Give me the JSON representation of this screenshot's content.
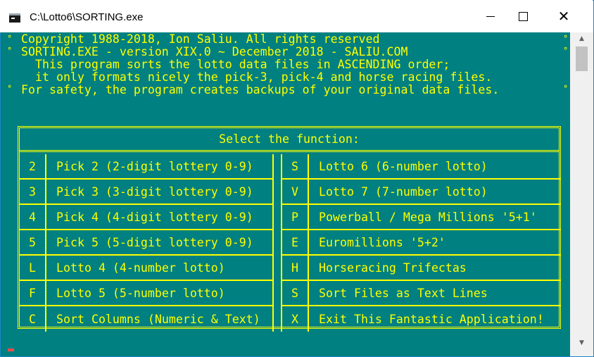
{
  "window": {
    "title": "C:\\Lotto6\\SORTING.exe",
    "buttons": {
      "minimize": "minimize",
      "maximize": "maximize",
      "close": "✕"
    }
  },
  "console": {
    "header_lines": [
      "Copyright 1988-2018, Ion Saliu. All rights reserved",
      "SORTING.EXE - version XIX.0 ~ December 2018 - SALIU.COM",
      "  This program sorts the lotto data files in ASCENDING order;",
      "  it only formats nicely the pick-3, pick-4 and horse racing files.",
      "For safety, the program creates backups of your original data files."
    ],
    "border_marker": "°"
  },
  "menu": {
    "title": "Select the function:",
    "left": [
      {
        "key": "2",
        "label": "Pick 2 (2-digit lottery 0-9)"
      },
      {
        "key": "3",
        "label": "Pick 3 (3-digit lottery 0-9)"
      },
      {
        "key": "4",
        "label": "Pick 4 (4-digit lottery 0-9)"
      },
      {
        "key": "5",
        "label": "Pick 5 (5-digit lottery 0-9)"
      },
      {
        "key": "L",
        "label": "Lotto 4 (4-number lotto)"
      },
      {
        "key": "F",
        "label": "Lotto 5 (5-number lotto)"
      },
      {
        "key": "C",
        "label": "Sort Columns (Numeric & Text)"
      }
    ],
    "right": [
      {
        "key": "S",
        "label": "Lotto 6 (6-number lotto)"
      },
      {
        "key": "V",
        "label": "Lotto 7 (7-number lotto)"
      },
      {
        "key": "P",
        "label": "Powerball / Mega Millions '5+1'"
      },
      {
        "key": "E",
        "label": "Euromillions '5+2'"
      },
      {
        "key": "H",
        "label": "Horseracing Trifectas"
      },
      {
        "key": "S",
        "label": "Sort Files as Text Lines"
      },
      {
        "key": "X",
        "label": "Exit This Fantastic Application!"
      }
    ]
  },
  "colors": {
    "console_bg": "#008080",
    "console_fg": "#ffff00",
    "frame": "#1d86c8"
  },
  "icons": {
    "app": "console-app-icon",
    "scroll_up": "chevron-up-icon",
    "scroll_down": "chevron-down-icon"
  }
}
